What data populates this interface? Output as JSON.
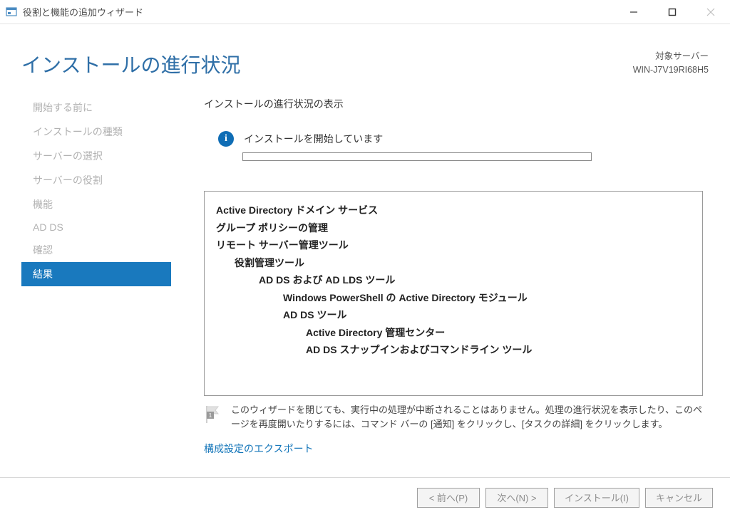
{
  "window": {
    "title": "役割と機能の追加ウィザード"
  },
  "header": {
    "page_title": "インストールの進行状況",
    "server_label": "対象サーバー",
    "server_name": "WIN-J7V19RI68H5"
  },
  "sidebar": {
    "items": [
      {
        "label": "開始する前に"
      },
      {
        "label": "インストールの種類"
      },
      {
        "label": "サーバーの選択"
      },
      {
        "label": "サーバーの役割"
      },
      {
        "label": "機能"
      },
      {
        "label": "AD DS"
      },
      {
        "label": "確認"
      },
      {
        "label": "結果"
      }
    ],
    "active_index": 7
  },
  "main": {
    "subtitle": "インストールの進行状況の表示",
    "status_text": "インストールを開始しています",
    "details": [
      {
        "text": "Active Directory ドメイン サービス",
        "indent": 0
      },
      {
        "text": "グループ ポリシーの管理",
        "indent": 0
      },
      {
        "text": "リモート サーバー管理ツール",
        "indent": 0
      },
      {
        "text": "役割管理ツール",
        "indent": 1
      },
      {
        "text": "AD DS および AD LDS ツール",
        "indent": 2
      },
      {
        "text": "Windows PowerShell の Active Directory モジュール",
        "indent": 3
      },
      {
        "text": "AD DS ツール",
        "indent": 3
      },
      {
        "text": "Active Directory 管理センター",
        "indent": 4
      },
      {
        "text": "AD DS スナップインおよびコマンドライン ツール",
        "indent": 4
      }
    ],
    "notice_text": "このウィザードを閉じても、実行中の処理が中断されることはありません。処理の進行状況を表示したり、このページを再度開いたりするには、コマンド バーの [通知] をクリックし、[タスクの詳細] をクリックします。",
    "export_label": "構成設定のエクスポート"
  },
  "footer": {
    "prev": "< 前へ(P)",
    "next": "次へ(N) >",
    "install": "インストール(I)",
    "cancel": "キャンセル"
  }
}
